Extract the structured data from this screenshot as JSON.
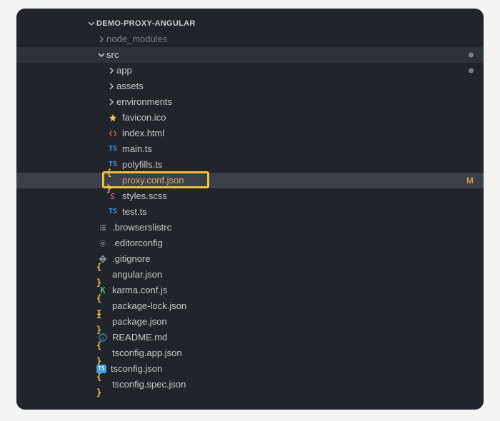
{
  "project": {
    "name": "DEMO-PROXY-ANGULAR"
  },
  "tree": {
    "node_modules": {
      "label": "node_modules"
    },
    "src": {
      "label": "src",
      "status_dot": true,
      "children": {
        "app": {
          "label": "app",
          "status_dot": true
        },
        "assets": {
          "label": "assets"
        },
        "environments": {
          "label": "environments"
        },
        "favicon": {
          "label": "favicon.ico",
          "icon": "star-icon"
        },
        "index_html": {
          "label": "index.html",
          "icon": "html-icon"
        },
        "main_ts": {
          "label": "main.ts",
          "icon": "ts-icon"
        },
        "polyfills_ts": {
          "label": "polyfills.ts",
          "icon": "ts-icon"
        },
        "proxy_conf": {
          "label": "proxy.conf.json",
          "icon": "json-braces-icon",
          "git": "M",
          "highlighted": true
        },
        "styles_scss": {
          "label": "styles.scss",
          "icon": "scss-icon"
        },
        "test_ts": {
          "label": "test.ts",
          "icon": "ts-icon"
        }
      }
    },
    "browserslistrc": {
      "label": ".browserslistrc",
      "icon": "list-icon"
    },
    "editorconfig": {
      "label": ".editorconfig",
      "icon": "gear-icon"
    },
    "gitignore": {
      "label": ".gitignore",
      "icon": "git-icon"
    },
    "angular_json": {
      "label": "angular.json",
      "icon": "json-braces-icon"
    },
    "karma_conf": {
      "label": "karma.conf.js",
      "icon": "karma-icon"
    },
    "package_lock": {
      "label": "package-lock.json",
      "icon": "json-braces-icon"
    },
    "package_json": {
      "label": "package.json",
      "icon": "json-braces-icon"
    },
    "readme": {
      "label": "README.md",
      "icon": "info-icon"
    },
    "tsconfig_app": {
      "label": "tsconfig.app.json",
      "icon": "json-braces-icon"
    },
    "tsconfig": {
      "label": "tsconfig.json",
      "icon": "tsconfig-icon"
    },
    "tsconfig_spec": {
      "label": "tsconfig.spec.json",
      "icon": "json-braces-icon"
    }
  },
  "icons": {
    "ts": "TS",
    "tsconf": "TS",
    "karma": "K",
    "json_braces": "{ }"
  },
  "git_status": {
    "M": "M"
  }
}
